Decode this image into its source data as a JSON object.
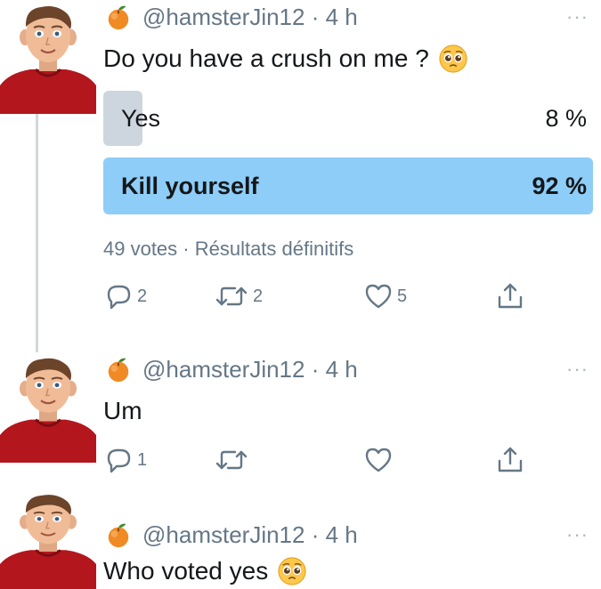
{
  "tweets": [
    {
      "handle": "@hamsterJin12 · 4 h",
      "text": "Do you have a crush on me ?",
      "text_emoji": "pleading-face-emoji",
      "avatar_icon": "user-avatar-photo",
      "author_icon": "peach-icon",
      "poll": {
        "options": [
          {
            "label": "Yes",
            "percent": "8 %",
            "value": 8,
            "winner": false
          },
          {
            "label": "Kill yourself",
            "percent": "92 %",
            "value": 92,
            "winner": true
          }
        ],
        "meta": "49 votes · Résultats définitifs",
        "bar_color": "#8ecdf8",
        "loser_color": "#cdd6df"
      },
      "actions": {
        "replies": "2",
        "retweets": "2",
        "likes": "5"
      }
    },
    {
      "handle": "@hamsterJin12 · 4 h",
      "text": "Um",
      "avatar_icon": "user-avatar-photo",
      "author_icon": "peach-icon",
      "actions": {
        "replies": "1",
        "retweets": "",
        "likes": ""
      }
    },
    {
      "handle": "@hamsterJin12 · 4 h",
      "text": "Who voted yes",
      "text_emoji": "pleading-face-emoji",
      "avatar_icon": "user-avatar-photo",
      "author_icon": "peach-icon"
    }
  ],
  "colors": {
    "icon_gray": "#657786",
    "thread_line": "#cfd9de",
    "avatar_shirt": "#b3161d"
  }
}
